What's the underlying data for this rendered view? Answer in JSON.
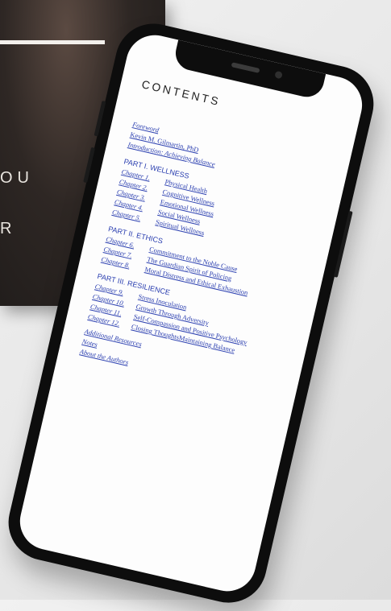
{
  "book_cover": {
    "line1": "OU",
    "line2": "R"
  },
  "toc": {
    "title": "CONTENTS",
    "front": [
      {
        "text": "Foreword",
        "italic": true
      },
      {
        "text": "Kevin M. Gilmartin, PhD",
        "italic": false
      },
      {
        "text": "Introduction: Achieving Balance",
        "italic": true
      }
    ],
    "parts": [
      {
        "title": "PART I.  WELLNESS",
        "chapters": [
          {
            "label": "Chapter 1.",
            "title": "Physical Health"
          },
          {
            "label": "Chapter 2.",
            "title": "Cognitive Wellness"
          },
          {
            "label": "Chapter 3.",
            "title": "Emotional Wellness"
          },
          {
            "label": "Chapter 4.",
            "title": "Social Wellness"
          },
          {
            "label": "Chapter 5.",
            "title": "Spiritual Wellness"
          }
        ]
      },
      {
        "title": "PART II.  ETHICS",
        "chapters": [
          {
            "label": "Chapter 6.",
            "title": "Commitment to the Noble Cause"
          },
          {
            "label": "Chapter 7.",
            "title": "The Guardian Spirit of Policing"
          },
          {
            "label": "Chapter 8.",
            "title": "Moral Distress and Ethical Exhaustion"
          }
        ]
      },
      {
        "title": "PART III.  RESILIENCE",
        "chapters": [
          {
            "label": "Chapter 9.",
            "title": "Stress Inoculation"
          },
          {
            "label": "Chapter 10.",
            "title": "Growth Through Adversity"
          },
          {
            "label": "Chapter 11.",
            "title": "Self-Compassion and Positive Psychology"
          },
          {
            "label": "Chapter 12.",
            "title": "Closing ThoughtsMaintaining Balance"
          }
        ]
      }
    ],
    "back": [
      {
        "text": "Additional Resources"
      },
      {
        "text": "Notes"
      },
      {
        "text": "About the Authors"
      }
    ]
  }
}
